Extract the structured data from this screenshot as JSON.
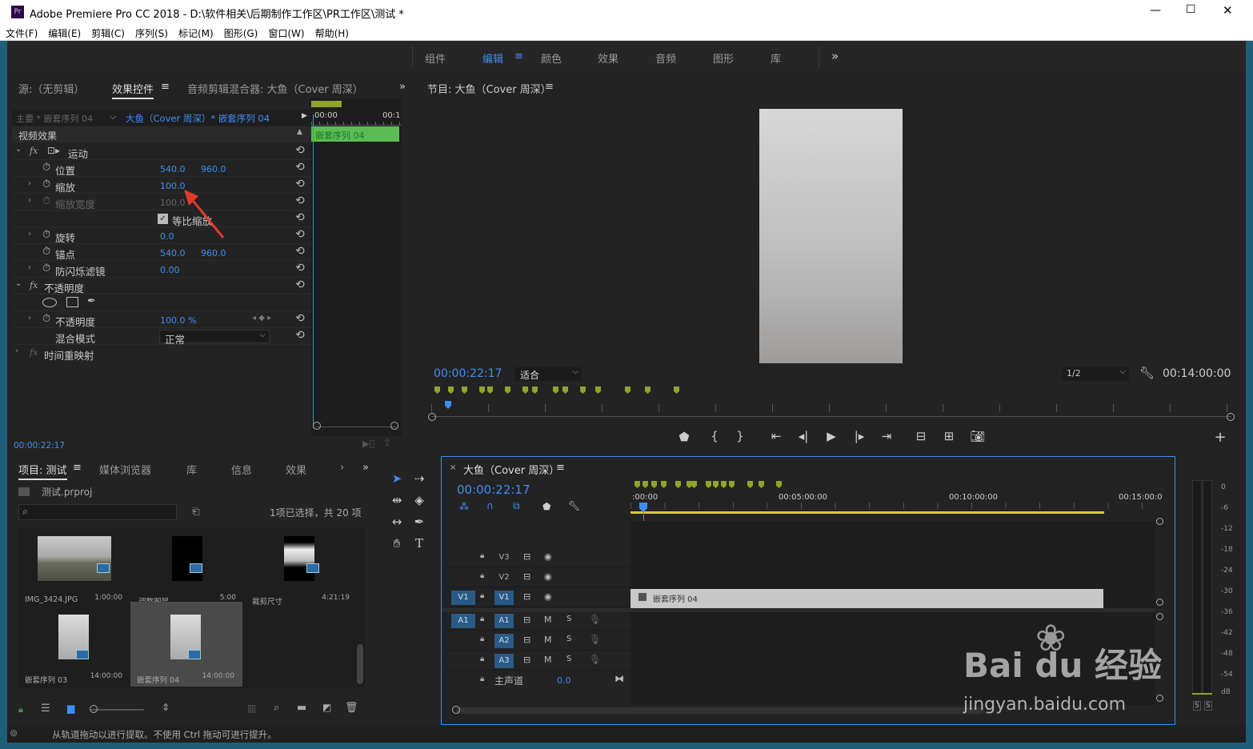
{
  "window": {
    "title": "Adobe Premiere Pro CC 2018 - D:\\软件相关\\后期制作工作区\\PR工作区\\测试 *",
    "app_icon": "Pr",
    "min": "—",
    "max": "☐",
    "close": "✕"
  },
  "menu": [
    "文件(F)",
    "编辑(E)",
    "剪辑(C)",
    "序列(S)",
    "标记(M)",
    "图形(G)",
    "窗口(W)",
    "帮助(H)"
  ],
  "workspaces": {
    "items": [
      "组件",
      "编辑",
      "颜色",
      "效果",
      "音频",
      "图形",
      "库"
    ],
    "active": "编辑",
    "more": "»"
  },
  "effect_panel": {
    "tabs": [
      "源:（无剪辑）",
      "效果控件",
      "音频剪辑混合器: 大鱼（Cover 周深）"
    ],
    "master_clip": "主要 * 嵌套序列 04",
    "clip_path": "大鱼（Cover 周深）* 嵌套序列 04",
    "mini_time_start": "00:00",
    "mini_time_end": "00:1",
    "mini_clip": "嵌套序列 04",
    "video_effects": "视频效果",
    "motion": "运动",
    "position": {
      "label": "位置",
      "x": "540.0",
      "y": "960.0"
    },
    "scale": {
      "label": "缩放",
      "value": "100.0"
    },
    "scale_width": {
      "label": "缩放宽度",
      "value": "100.0"
    },
    "uniform_scale": "等比缩放",
    "rotation": {
      "label": "旋转",
      "value": "0.0"
    },
    "anchor": {
      "label": "锚点",
      "x": "540.0",
      "y": "960.0"
    },
    "anti_flicker": {
      "label": "防闪烁滤镜",
      "value": "0.00"
    },
    "opacity_section": "不透明度",
    "opacity": {
      "label": "不透明度",
      "value": "100.0 %"
    },
    "blend_mode": {
      "label": "混合模式",
      "value": "正常"
    },
    "time_remap": "时间重映射",
    "current_time": "00:00:22:17"
  },
  "program": {
    "title": "节目: 大鱼（Cover 周深）",
    "timecode": "00:00:22:17",
    "fit": "适合",
    "resolution": "1/2",
    "duration": "00:14:00:00"
  },
  "project": {
    "tabs": [
      "项目: 测试",
      "媒体浏览器",
      "库",
      "信息",
      "效果",
      "›"
    ],
    "file": "测试.prproj",
    "search_placeholder": "",
    "selection": "1项已选择，共 20 项",
    "items": [
      {
        "name": "IMG_3424.JPG",
        "duration": "1:00:00"
      },
      {
        "name": "调整图层",
        "duration": "5:00"
      },
      {
        "name": "裁剪尺寸",
        "duration": "4:21:19"
      },
      {
        "name": "嵌套序列 03",
        "duration": "14:00:00"
      },
      {
        "name": "嵌套序列 04",
        "duration": "14:00:00"
      }
    ]
  },
  "timeline": {
    "title": "大鱼（Cover 周深）",
    "timecode": "00:00:22:17",
    "ruler": [
      ":00:00",
      "00:05:00:00",
      "00:10:00:00",
      "00:15:00:0"
    ],
    "clip": "嵌套序列 04",
    "video_tracks": [
      "V3",
      "V2",
      "V1"
    ],
    "audio_tracks": [
      "A1",
      "A2",
      "A3"
    ],
    "source_v": "V1",
    "source_a": "A1",
    "master": {
      "label": "主声道",
      "value": "0.0"
    }
  },
  "meter": {
    "scale": [
      "0",
      "-6",
      "-12",
      "-18",
      "-24",
      "-30",
      "-36",
      "-42",
      "-48",
      "-54",
      "dB"
    ],
    "solo": [
      "S",
      "S"
    ]
  },
  "status": "从轨道拖动以进行提取。不使用 Ctrl 拖动可进行提升。",
  "watermark": {
    "brand": "Bai du 经验",
    "url": "jingyan.baidu.com"
  },
  "colors": {
    "accent": "#3e8ef5",
    "marker": "#8ea42b",
    "clip_green": "#5dbb54",
    "frame": "#1e5e79"
  }
}
